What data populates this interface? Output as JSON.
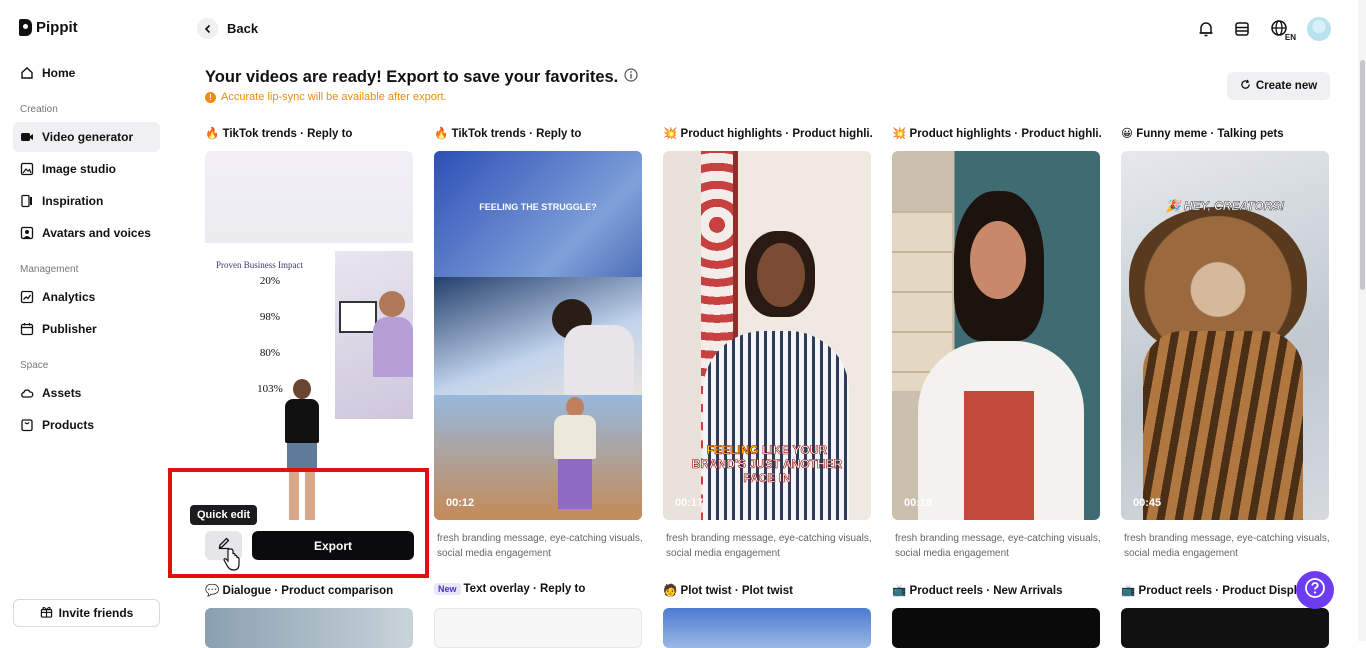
{
  "app": {
    "name": "Pippit"
  },
  "sidebar": {
    "home": "Home",
    "sections": {
      "creation": "Creation",
      "management": "Management",
      "space": "Space"
    },
    "items": [
      {
        "label": "Video generator",
        "icon": "video-icon",
        "active": true
      },
      {
        "label": "Image studio",
        "icon": "image-icon"
      },
      {
        "label": "Inspiration",
        "icon": "book-icon"
      },
      {
        "label": "Avatars and voices",
        "icon": "avatar-icon"
      },
      {
        "label": "Analytics",
        "icon": "chart-icon"
      },
      {
        "label": "Publisher",
        "icon": "calendar-icon"
      },
      {
        "label": "Assets",
        "icon": "cloud-icon"
      },
      {
        "label": "Products",
        "icon": "bag-icon"
      }
    ],
    "invite": "Invite friends"
  },
  "header": {
    "back": "Back",
    "language": "EN"
  },
  "main": {
    "headline": "Your videos are ready! Export to save your favorites.",
    "notice": "Accurate lip-sync will be available after export.",
    "create_new": "Create new",
    "cards": [
      {
        "emoji": "🔥",
        "title": "TikTok trends · Reply to",
        "duration": "",
        "desc": ""
      },
      {
        "emoji": "🔥",
        "title": "TikTok trends · Reply to",
        "duration": "00:12",
        "desc": "fresh branding message, eye-catching visuals, social media engagement",
        "caption": "FEELING THE STRUGGLE?"
      },
      {
        "emoji": "💥",
        "title": "Product highlights · Product highli...",
        "duration": "00:17",
        "desc": "fresh branding message, eye-catching visuals, social media engagement",
        "caption": "FEELING LIKE YOUR BRAND'S JUST ANOTHER FACE IN"
      },
      {
        "emoji": "💥",
        "title": "Product highlights · Product highli...",
        "duration": "00:18",
        "desc": "fresh branding message, eye-catching visuals, social media engagement"
      },
      {
        "emoji": "😀",
        "title": "Funny meme · Talking pets",
        "duration": "00:45",
        "desc": "fresh branding message, eye-catching visuals, social media engagement",
        "caption": "🎉 HEY, CREATORS!"
      }
    ],
    "row2": [
      {
        "emoji": "💬",
        "title": "Dialogue · Product comparison"
      },
      {
        "badge": "New",
        "title": "Text overlay · Reply to"
      },
      {
        "emoji": "🧑",
        "title": "Plot twist · Plot twist"
      },
      {
        "emoji": "📺",
        "title": "Product reels · New Arrivals"
      },
      {
        "emoji": "📺",
        "title": "Product reels · Product Display"
      }
    ],
    "first_card_doc": {
      "title": "Proven Business Impact",
      "stats": [
        "20%",
        "98%",
        "80%",
        "103%"
      ]
    },
    "quick_edit": "Quick edit",
    "export": "Export"
  }
}
